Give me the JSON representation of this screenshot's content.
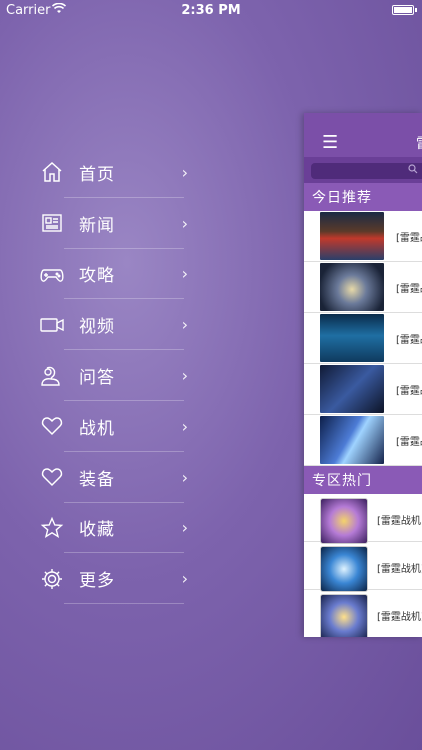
{
  "status_bar": {
    "carrier": "Carrier",
    "time": "2:36 PM"
  },
  "menu": {
    "items": [
      {
        "label": "首页",
        "icon": "home-icon"
      },
      {
        "label": "新闻",
        "icon": "newspaper-icon"
      },
      {
        "label": "攻略",
        "icon": "gamepad-icon"
      },
      {
        "label": "视频",
        "icon": "video-camera-icon"
      },
      {
        "label": "问答",
        "icon": "person-question-icon"
      },
      {
        "label": "战机",
        "icon": "heart-icon"
      },
      {
        "label": "装备",
        "icon": "heart-icon"
      },
      {
        "label": "收藏",
        "icon": "star-icon"
      },
      {
        "label": "更多",
        "icon": "gear-icon"
      }
    ],
    "chevron": "›"
  },
  "panel": {
    "hamburger": "☰",
    "title_partial": "雷",
    "search_icon": "🔍",
    "section_today": "今日推荐",
    "section_hot": "专区热门",
    "today_items": [
      {
        "text": "[雷霆战"
      },
      {
        "text": "[雷霆战"
      },
      {
        "text": "[雷霆战"
      },
      {
        "text": "[雷霆战"
      },
      {
        "text": "[雷霆战"
      }
    ],
    "hot_items": [
      {
        "text": "[雷霆战机"
      },
      {
        "text": "[雷霆战机]"
      },
      {
        "text": "[雷霆战机]"
      }
    ]
  },
  "colors": {
    "nav": "#7b4fa8",
    "section": "#8a5ab6",
    "bg": "#7d63ad"
  }
}
